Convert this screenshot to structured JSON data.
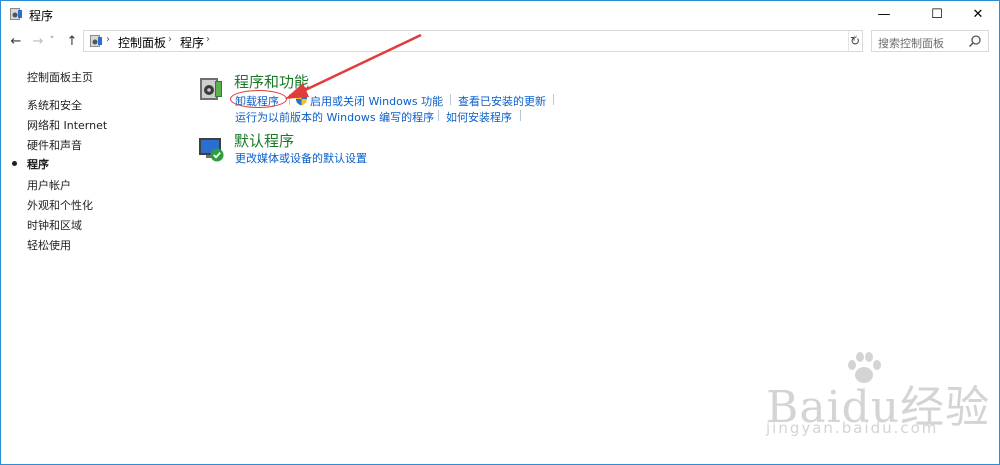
{
  "window": {
    "title": "程序",
    "minimize_glyph": "—",
    "maximize_glyph": "☐",
    "close_glyph": "✕"
  },
  "nav": {
    "back_glyph": "←",
    "forward_glyph": "→",
    "dropdown_glyph": "˅",
    "up_glyph": "↑",
    "breadcrumb": [
      "控制面板",
      "程序"
    ],
    "separator_glyph": "›",
    "refresh_glyph": "↻",
    "search_placeholder": "搜索控制面板"
  },
  "sidebar": {
    "items": [
      {
        "label": "控制面板主页",
        "active": false
      },
      {
        "label": "系统和安全",
        "active": false
      },
      {
        "label": "网络和 Internet",
        "active": false
      },
      {
        "label": "硬件和声音",
        "active": false
      },
      {
        "label": "程序",
        "active": true
      },
      {
        "label": "用户帐户",
        "active": false
      },
      {
        "label": "外观和个性化",
        "active": false
      },
      {
        "label": "时钟和区域",
        "active": false
      },
      {
        "label": "轻松使用",
        "active": false
      }
    ]
  },
  "content": {
    "programs_features": {
      "title": "程序和功能",
      "links": [
        "卸载程序",
        "启用或关闭 Windows 功能",
        "查看已安装的更新",
        "运行为以前版本的 Windows 编写的程序",
        "如何安装程序"
      ]
    },
    "default_programs": {
      "title": "默认程序",
      "links": [
        "更改媒体或设备的默认设置"
      ]
    }
  },
  "annotation": {
    "color": "#e23b3b"
  },
  "watermark": {
    "main": "Baidu经验",
    "sub": "jingyan.baidu.com"
  },
  "colors": {
    "link": "#0b5fc8",
    "category_title": "#1a7a2a",
    "window_border": "#2b8cd8"
  }
}
